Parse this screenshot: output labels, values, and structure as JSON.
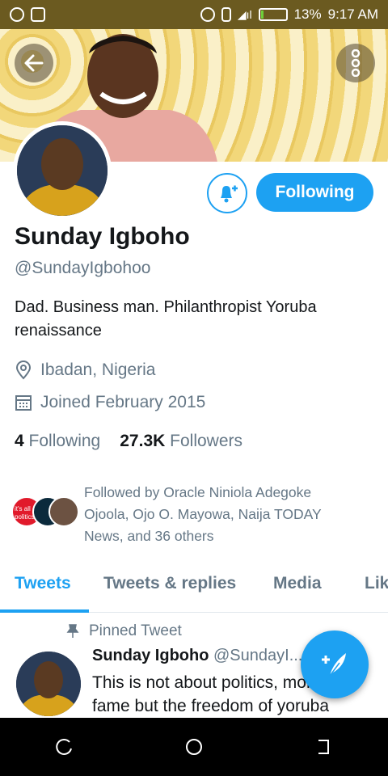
{
  "status_bar": {
    "battery": "13%",
    "time": "9:17 AM",
    "battery_level": 0.13
  },
  "colors": {
    "accent": "#1da1f2",
    "status_bar": "#6b5a20"
  },
  "header": {
    "back_icon": "arrow-left-icon",
    "more_icon": "more-vertical-icon"
  },
  "profile": {
    "name": "Sunday Igboho",
    "handle": "@SundayIgbohoo",
    "bio": "Dad. Business man. Philanthropist Yoruba renaissance",
    "location": "Ibadan, Nigeria",
    "joined": "Joined February 2015",
    "following_count": "4",
    "following_label": "Following",
    "followers_count": "27.3K",
    "followers_label": "Followers",
    "follow_button": "Following",
    "followed_by": "Followed by Oracle Niniola Adegoke Ojoola, Ojo O. Mayowa, Naija TODAY News, and 36 others",
    "mini_avatar_text": "it's all politics"
  },
  "tabs": [
    {
      "label": "Tweets",
      "active": true
    },
    {
      "label": "Tweets & replies",
      "active": false
    },
    {
      "label": "Media",
      "active": false
    },
    {
      "label": "Lik",
      "active": false
    }
  ],
  "tweet": {
    "pinned_label": "Pinned Tweet",
    "author": "Sunday Igboho",
    "handle": "@SundayI...",
    "text": "This is not about politics, money, fame but the freedom of yoruba"
  }
}
